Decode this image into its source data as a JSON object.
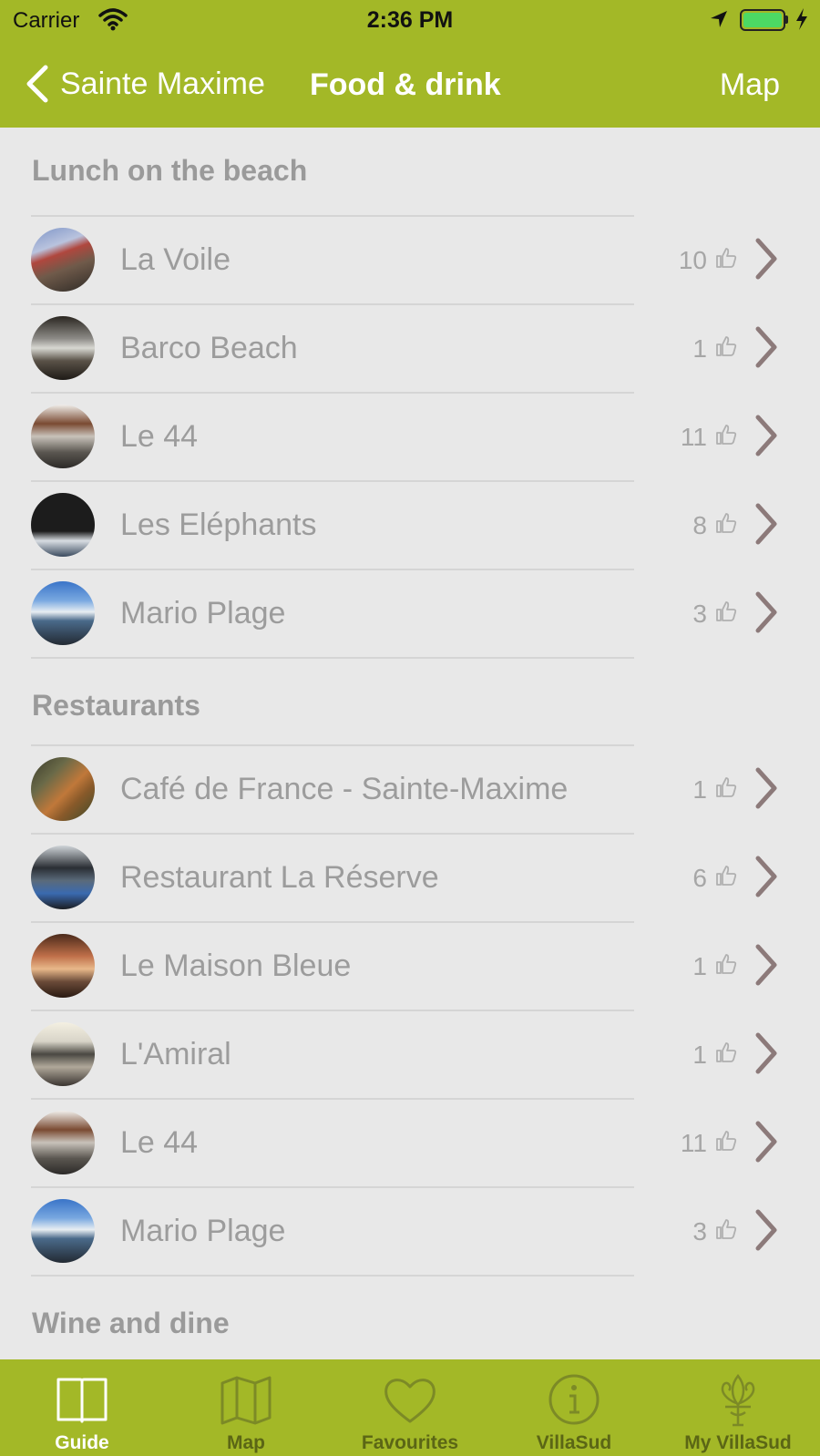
{
  "status_bar": {
    "carrier": "Carrier",
    "time": "2:36 PM",
    "battery_color": "#4cd964"
  },
  "nav": {
    "back_label": "Sainte Maxime",
    "title": "Food & drink",
    "map_label": "Map"
  },
  "theme": {
    "bar_color": "#a3b827",
    "background": "#e8e8e8",
    "chevron_color": "#8c7a7a"
  },
  "sections": [
    {
      "header": "Lunch on the beach",
      "items": [
        {
          "name": "La Voile",
          "likes": "10",
          "thumb": "beach-umbrella"
        },
        {
          "name": "Barco Beach",
          "likes": "1",
          "thumb": "beach-terrace"
        },
        {
          "name": "Le 44",
          "likes": "11",
          "thumb": "beach-restaurant"
        },
        {
          "name": "Les Eléphants",
          "likes": "8",
          "thumb": "restaurant-sign"
        },
        {
          "name": "Mario Plage",
          "likes": "3",
          "thumb": "beach-sea"
        }
      ]
    },
    {
      "header": "Restaurants",
      "items": [
        {
          "name": "Café de France - Sainte-Maxime",
          "likes": "1",
          "thumb": "cafe-terrace"
        },
        {
          "name": "Restaurant La Réserve",
          "likes": "6",
          "thumb": "restaurant-front"
        },
        {
          "name": "Le Maison Bleue",
          "likes": "1",
          "thumb": "restaurant-interior"
        },
        {
          "name": "L'Amiral",
          "likes": "1",
          "thumb": "seaside-terrace"
        },
        {
          "name": "Le 44",
          "likes": "11",
          "thumb": "beach-restaurant"
        },
        {
          "name": "Mario Plage",
          "likes": "3",
          "thumb": "beach-sea"
        }
      ]
    },
    {
      "header": "Wine and dine",
      "items": []
    }
  ],
  "tabs": [
    {
      "label": "Guide",
      "icon": "book-icon",
      "active": true
    },
    {
      "label": "Map",
      "icon": "map-icon",
      "active": false
    },
    {
      "label": "Favourites",
      "icon": "heart-icon",
      "active": false
    },
    {
      "label": "VillaSud",
      "icon": "info-icon",
      "active": false
    },
    {
      "label": "My VillaSud",
      "icon": "fleur-de-lis-icon",
      "active": false
    }
  ]
}
